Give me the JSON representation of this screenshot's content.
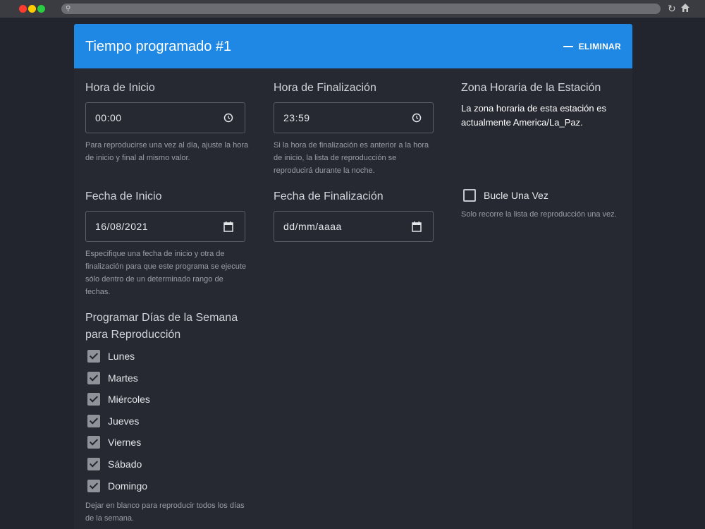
{
  "card": {
    "title": "Tiempo programado #1",
    "delete_label": "ELIMINAR"
  },
  "start_time": {
    "label": "Hora de Inicio",
    "value": "00:00",
    "help": "Para reproducirse una vez al día, ajuste la hora de inicio y final al mismo valor."
  },
  "end_time": {
    "label": "Hora de Finalización",
    "value": "23:59",
    "help": "Si la hora de finalización es anterior a la hora de inicio, la lista de reproducción se reproducirá durante la noche."
  },
  "timezone": {
    "label": "Zona Horaria de la Estación",
    "text": "La zona horaria de esta estación es actualmente America/La_Paz."
  },
  "start_date": {
    "label": "Fecha de Inicio",
    "value": "16/08/2021",
    "help": "Especifique una fecha de inicio y otra de finalización para que este programa se ejecute sólo dentro de un determinado rango de fechas."
  },
  "end_date": {
    "label": "Fecha de Finalización",
    "value": "dd/mm/aaaa"
  },
  "loop_once": {
    "label": "Bucle Una Vez",
    "checked": false,
    "help": "Solo recorre la lista de reproducción una vez."
  },
  "weekdays": {
    "label": "Programar Días de la Semana para Reproducción",
    "help": "Dejar en blanco para reproducir todos los días de la semana.",
    "days": [
      {
        "label": "Lunes",
        "checked": true
      },
      {
        "label": "Martes",
        "checked": true
      },
      {
        "label": "Miércoles",
        "checked": true
      },
      {
        "label": "Jueves",
        "checked": true
      },
      {
        "label": "Viernes",
        "checked": true
      },
      {
        "label": "Sábado",
        "checked": true
      },
      {
        "label": "Domingo",
        "checked": true
      }
    ]
  },
  "colors": {
    "header": "#1f88e5",
    "background": "#23252e",
    "card": "#262932"
  }
}
